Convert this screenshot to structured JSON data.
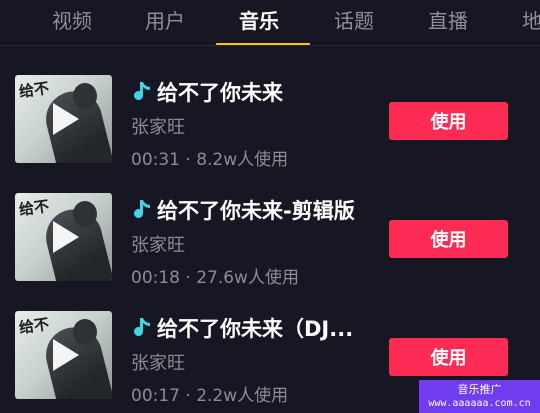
{
  "tabs": [
    {
      "label": "视频"
    },
    {
      "label": "用户"
    },
    {
      "label": "音乐",
      "active": true
    },
    {
      "label": "话题"
    },
    {
      "label": "直播"
    },
    {
      "label": "地"
    }
  ],
  "songs": [
    {
      "title": "给不了你未来",
      "artist": "张家旺",
      "meta": "00:31 · 8.2w人使用",
      "cover_text": "给不",
      "button": "使用"
    },
    {
      "title": "给不了你未来-剪辑版",
      "artist": "张家旺",
      "meta": "00:18 · 27.6w人使用",
      "cover_text": "给不",
      "button": "使用"
    },
    {
      "title": "给不了你未来（DJ...",
      "artist": "张家旺",
      "meta": "00:17 · 2.2w人使用",
      "cover_text": "给不",
      "button": "使用"
    }
  ],
  "watermark": {
    "line1": "音乐推广",
    "line2": "www.aaaaaa.com.cn"
  },
  "colors": {
    "accent": "#fe2c55",
    "tab_indicator": "#f7c317",
    "note_icon": "#3fd6e8",
    "background": "#161722"
  },
  "icons": {
    "music_note": "music-note-icon",
    "play": "play-icon"
  }
}
